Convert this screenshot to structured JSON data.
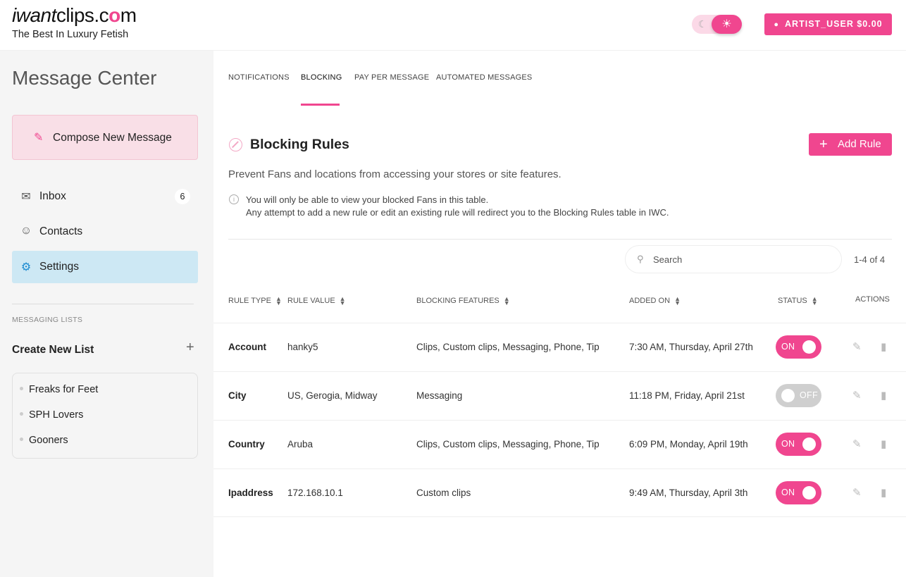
{
  "brand": {
    "logo_left": "iwant",
    "logo_right": "clips.c",
    "logo_o": "o",
    "logo_m": "m",
    "tagline": "The Best In Luxury Fetish"
  },
  "header": {
    "theme_icons": {
      "moon": "moon-icon",
      "sun": "sun-icon"
    },
    "user_button": "ARTIST_USER $0.00"
  },
  "sidebar": {
    "title": "Message Center",
    "compose_label": "Compose New Message",
    "nav": [
      {
        "label": "Inbox",
        "icon": "mail-icon",
        "badge": "6"
      },
      {
        "label": "Contacts",
        "icon": "contacts-icon"
      },
      {
        "label": "Settings",
        "icon": "gear-icon"
      }
    ],
    "section_label": "MESSAGING LISTS",
    "create_list": "Create New List",
    "lists": [
      "Freaks for Feet",
      "SPH Lovers",
      "Gooners"
    ]
  },
  "tabs": [
    {
      "label": "NOTIFICATIONS"
    },
    {
      "label": "BLOCKING"
    },
    {
      "label": "PAY PER MESSAGE"
    },
    {
      "label": "AUTOMATED MESSAGES"
    }
  ],
  "blocking": {
    "title": "Blocking Rules",
    "add_rule": "Add Rule",
    "description": "Prevent Fans and locations from accessing your stores or site features.",
    "note_line1": "You will only be able to view your blocked Fans in this table.",
    "note_line2": "Any attempt to add a new rule or edit an existing rule will redirect you to the Blocking Rules table in IWC.",
    "search_placeholder": "Search",
    "pager": "1-4 of 4",
    "columns": {
      "rule_type": "RULE TYPE",
      "rule_value": "RULE VALUE",
      "features": "BLOCKING FEATURES",
      "added_on": "ADDED ON",
      "status": "STATUS",
      "actions": "ACTIONS"
    },
    "rows": [
      {
        "type": "Account",
        "value": "hanky5",
        "features": "Clips, Custom clips, Messaging, Phone, Tip",
        "added": "7:30 AM, Thursday, April 27th",
        "status": "ON"
      },
      {
        "type": "City",
        "value": "US, Gerogia, Midway",
        "features": "Messaging",
        "added": "11:18 PM, Friday, April 21st",
        "status": "OFF"
      },
      {
        "type": "Country",
        "value": "Aruba",
        "features": "Clips, Custom clips, Messaging, Phone, Tip",
        "added": "6:09 PM, Monday, April 19th",
        "status": "ON"
      },
      {
        "type": "Ipaddress",
        "value": "172.168.10.1",
        "features": "Custom clips",
        "added": "9:49 AM, Thursday, April 3th",
        "status": "ON"
      }
    ]
  },
  "colors": {
    "accent": "#f0468f",
    "active_nav": "#cde8f4",
    "settings_icon": "#1b8bd1"
  }
}
